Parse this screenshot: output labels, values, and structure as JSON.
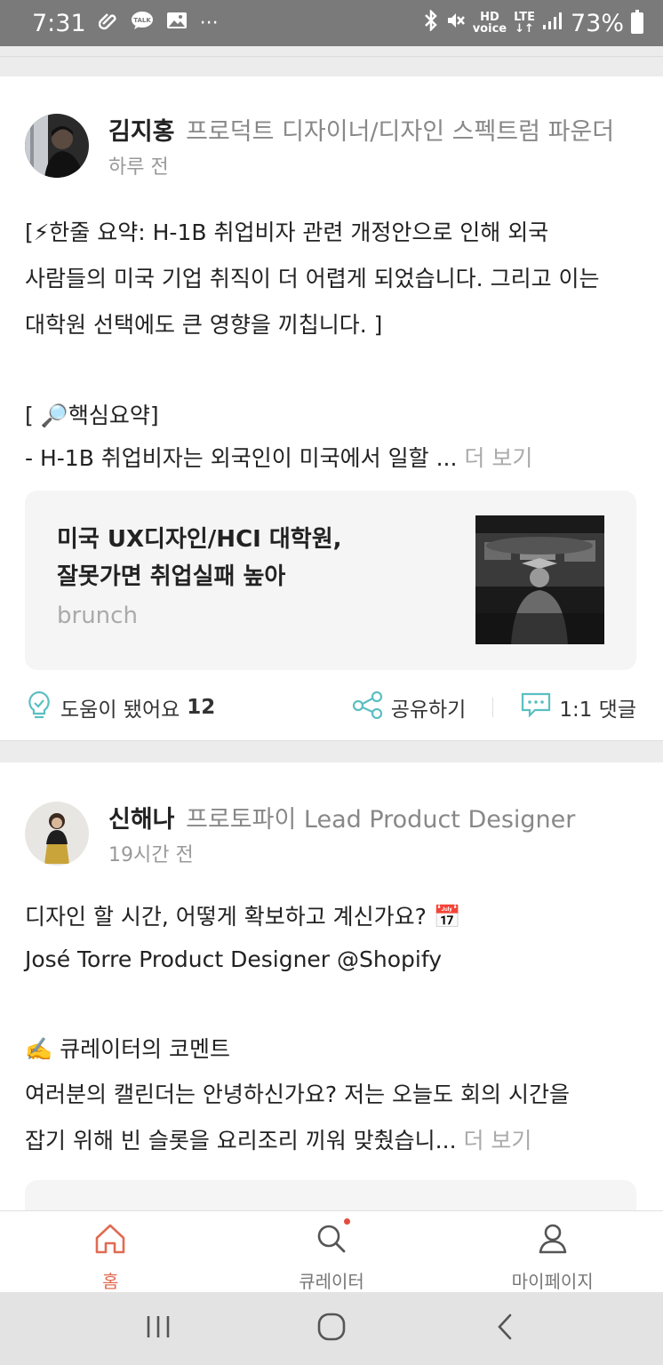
{
  "status_bar": {
    "time": "7:31",
    "battery": "73%",
    "network": "LTE"
  },
  "posts": [
    {
      "author_name": "김지홍",
      "author_role": "프로덕트 디자이너/디자인 스펙트럼 파운더",
      "time": "하루 전",
      "body_lines": [
        "[⚡한줄 요약: H-1B 취업비자 관련 개정안으로 인해 외국",
        "사람들의 미국 기업 취직이 더 어렵게 되었습니다. 그리고 이는",
        "대학원 선택에도 큰 영향을 끼칩니다. ]",
        "",
        "[ 🔎핵심요약]",
        "- H-1B 취업비자는 외국인이 미국에서 일할 ..."
      ],
      "more_label": "더 보기",
      "link": {
        "title_line1": "미국 UX디자인/HCI 대학원,",
        "title_line2": "잘못가면 취업실패 높아",
        "source": "brunch"
      },
      "helpful_label": "도움이 됐어요",
      "helpful_count": "12",
      "share_label": "공유하기",
      "comment_label": "1:1 댓글"
    },
    {
      "author_name": "신해나",
      "author_role": "프로토파이 Lead Product Designer",
      "time": "19시간 전",
      "body_lines": [
        "디자인 할 시간, 어떻게 확보하고 계신가요? 📅",
        "José Torre Product Designer @Shopify",
        "",
        "✍️ 큐레이터의 코멘트",
        "여러분의 캘린더는 안녕하신가요? 저는 오늘도 회의 시간을",
        "잡기 위해 빈 슬롯을 요리조리 끼워 맞췄습니..."
      ],
      "more_label": "더 보기"
    }
  ],
  "bottom_nav": {
    "home": "홈",
    "curator": "큐레이터",
    "mypage": "마이페이지"
  },
  "colors": {
    "accent": "#e06b52",
    "teal_icon": "#5bbfc2"
  }
}
